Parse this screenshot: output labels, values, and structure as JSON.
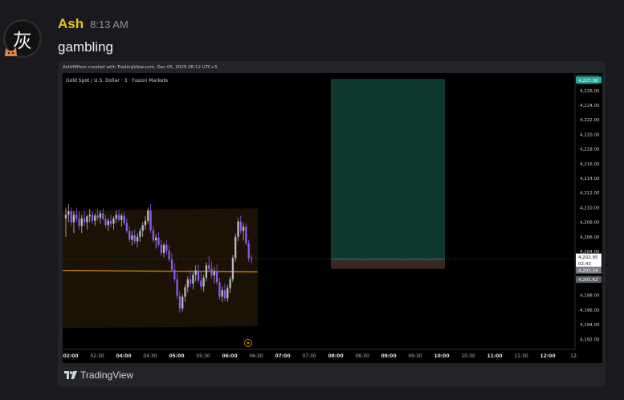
{
  "message": {
    "author": "Ash",
    "timestamp": "8:13 AM",
    "text": "gambling",
    "avatar_glyph": "灰",
    "author_color": "#f0c419"
  },
  "embed": {
    "credit": "AshHWhoo created with TradingView.com, Dec 05, 2025 08:12 UTC+5",
    "logo_text": "TradingView",
    "logo_icon": "tradingview-logo-icon"
  },
  "chart_data": {
    "type": "candlestick",
    "title": "Gold Spot / U.S. Dollar · 3 · Fusion Markets",
    "currency": "USD",
    "ylim": [
      4190.6,
      4228.4
    ],
    "y_ticks": [
      4192,
      4194,
      4196,
      4198,
      4204,
      4206,
      4208,
      4210,
      4212,
      4214,
      4216,
      4218,
      4220,
      4222,
      4224,
      4226
    ],
    "x_ticks": [
      "02:00",
      "02:30",
      "04:00",
      "04:30",
      "05:00",
      "05:30",
      "06:00",
      "06:30",
      "07:00",
      "07:30",
      "08:00",
      "08:30",
      "09:00",
      "09:30",
      "10:00",
      "10:30",
      "11:00",
      "11:30",
      "12:00",
      "12:"
    ],
    "price_labels": [
      {
        "text": "4,227.38",
        "color": "#26a69a"
      },
      {
        "text": "4,202.95",
        "color": "#ffffff"
      },
      {
        "text": "02:43",
        "color": "#ffffff"
      },
      {
        "text": "4,202.24",
        "color": "#787b86"
      },
      {
        "text": "4,201.62",
        "color": "#787b86"
      }
    ],
    "target_price": 4227.38,
    "entry_price": 4202.95,
    "stop_price": 4201.62,
    "ma_level": 4201.4,
    "candles": [
      [
        4208.5,
        4210,
        4206,
        4209
      ],
      [
        4209,
        4210.5,
        4208,
        4209.5
      ],
      [
        4209.5,
        4210,
        4207.5,
        4208
      ],
      [
        4208,
        4209.5,
        4206.5,
        4209
      ],
      [
        4209,
        4210,
        4208,
        4208.5
      ],
      [
        4208.5,
        4209.5,
        4207,
        4207.5
      ],
      [
        4207.5,
        4209,
        4206.5,
        4208.5
      ],
      [
        4208.5,
        4209.5,
        4207.5,
        4208
      ],
      [
        4208,
        4209,
        4207,
        4208.8
      ],
      [
        4208.8,
        4209.8,
        4208,
        4209
      ],
      [
        4209,
        4209.5,
        4207.8,
        4208.2
      ],
      [
        4208.2,
        4209.2,
        4207.5,
        4208.9
      ],
      [
        4208.9,
        4209.8,
        4208.2,
        4208.6
      ],
      [
        4208.6,
        4209.6,
        4207.8,
        4209.2
      ],
      [
        4209.2,
        4209.9,
        4208.3,
        4208.4
      ],
      [
        4208.4,
        4209,
        4207.2,
        4207.6
      ],
      [
        4207.6,
        4208.6,
        4206.8,
        4208.2
      ],
      [
        4208.2,
        4209,
        4207.3,
        4207.8
      ],
      [
        4207.8,
        4208.8,
        4207,
        4208.5
      ],
      [
        4208.5,
        4209.6,
        4207.9,
        4209
      ],
      [
        4209,
        4209.7,
        4208.1,
        4208.3
      ],
      [
        4208.3,
        4209.2,
        4207.4,
        4208.9
      ],
      [
        4208.9,
        4209.4,
        4207.6,
        4207.9
      ],
      [
        4207.9,
        4208.5,
        4206.5,
        4206.8
      ],
      [
        4206.8,
        4207.5,
        4205.3,
        4205.6
      ],
      [
        4205.6,
        4206.8,
        4204.8,
        4206.2
      ],
      [
        4206.2,
        4207,
        4205,
        4205.4
      ],
      [
        4205.4,
        4206.5,
        4204.6,
        4206
      ],
      [
        4206,
        4207.2,
        4205.3,
        4206.8
      ],
      [
        4206.8,
        4208,
        4206,
        4207.6
      ],
      [
        4207.6,
        4208.8,
        4207,
        4208.2
      ],
      [
        4208.2,
        4210,
        4207.8,
        4209.6
      ],
      [
        4209.6,
        4210.5,
        4206.5,
        4206.9
      ],
      [
        4206.9,
        4207.5,
        4205.2,
        4205.5
      ],
      [
        4205.5,
        4206.4,
        4204.4,
        4205.9
      ],
      [
        4205.9,
        4206.6,
        4204.6,
        4204.9
      ],
      [
        4204.9,
        4205.6,
        4203.4,
        4203.8
      ],
      [
        4203.8,
        4205.2,
        4203.2,
        4204.9
      ],
      [
        4204.9,
        4205.5,
        4203.6,
        4204.1
      ],
      [
        4204.1,
        4204.9,
        4202.6,
        4202.9
      ],
      [
        4202.9,
        4203.8,
        4201.2,
        4201.5
      ],
      [
        4201.5,
        4202.4,
        4199.8,
        4200.2
      ],
      [
        4200.2,
        4201,
        4197.5,
        4197.9
      ],
      [
        4197.9,
        4198.6,
        4195.6,
        4196.2
      ],
      [
        4196.2,
        4198.2,
        4195.8,
        4197.8
      ],
      [
        4197.8,
        4199.5,
        4197.1,
        4199.1
      ],
      [
        4199.1,
        4200.6,
        4198.4,
        4200.2
      ],
      [
        4200.2,
        4201.5,
        4199.1,
        4199.6
      ],
      [
        4199.6,
        4201.2,
        4198.8,
        4200.8
      ],
      [
        4200.8,
        4202.1,
        4199.9,
        4201.4
      ],
      [
        4201.4,
        4202.2,
        4199.6,
        4200
      ],
      [
        4200,
        4201.3,
        4198.8,
        4199.2
      ],
      [
        4199.2,
        4200.8,
        4198.5,
        4200.4
      ],
      [
        4200.4,
        4202.5,
        4199.9,
        4202.1
      ],
      [
        4202.1,
        4203.4,
        4201.2,
        4201.6
      ],
      [
        4201.6,
        4202.6,
        4200.3,
        4200.7
      ],
      [
        4200.7,
        4201.9,
        4199.6,
        4201.3
      ],
      [
        4201.3,
        4202.2,
        4199.4,
        4199.8
      ],
      [
        4199.8,
        4200.4,
        4197.4,
        4197.8
      ],
      [
        4197.8,
        4199.2,
        4197.1,
        4198.7
      ],
      [
        4198.7,
        4199.6,
        4197.2,
        4197.6
      ],
      [
        4197.6,
        4199.4,
        4197.1,
        4199
      ],
      [
        4199,
        4200.6,
        4198.3,
        4200.2
      ],
      [
        4200.2,
        4203.5,
        4199.8,
        4203.1
      ],
      [
        4203.1,
        4206.4,
        4202.6,
        4206
      ],
      [
        4206,
        4208.6,
        4205.4,
        4208.1
      ],
      [
        4208.1,
        4208.9,
        4206.4,
        4206.8
      ],
      [
        4206.8,
        4207.9,
        4205.5,
        4207.4
      ],
      [
        4207.4,
        4207.8,
        4204.8,
        4205.1
      ],
      [
        4205.1,
        4205.6,
        4202.6,
        4203.1
      ],
      [
        4203.1,
        4203.5,
        4202.4,
        4202.95
      ]
    ]
  }
}
